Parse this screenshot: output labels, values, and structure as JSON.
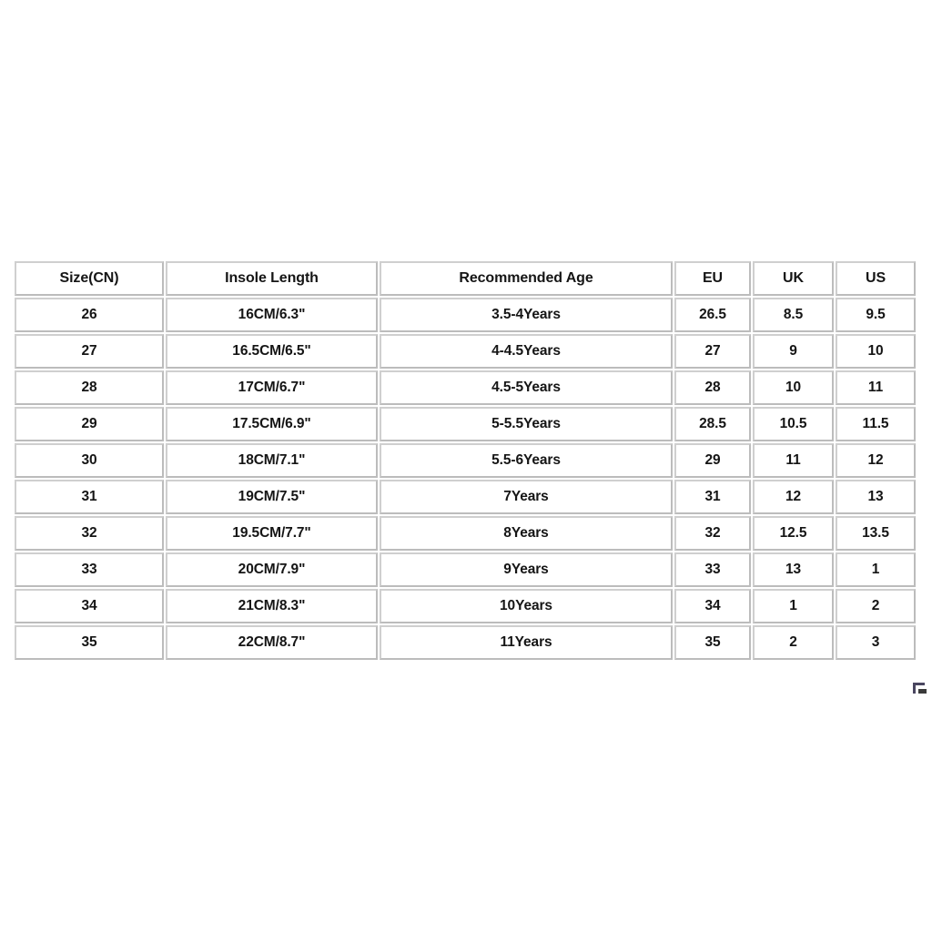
{
  "table": {
    "headers": [
      "Size(CN)",
      "Insole Length",
      "Recommended Age",
      "EU",
      "UK",
      "US"
    ],
    "rows": [
      {
        "size_cn": "26",
        "insole_length": "16CM/6.3\"",
        "recommended_age": "3.5-4Years",
        "eu": "26.5",
        "uk": "8.5",
        "us": "9.5"
      },
      {
        "size_cn": "27",
        "insole_length": "16.5CM/6.5\"",
        "recommended_age": "4-4.5Years",
        "eu": "27",
        "uk": "9",
        "us": "10"
      },
      {
        "size_cn": "28",
        "insole_length": "17CM/6.7\"",
        "recommended_age": "4.5-5Years",
        "eu": "28",
        "uk": "10",
        "us": "11"
      },
      {
        "size_cn": "29",
        "insole_length": "17.5CM/6.9\"",
        "recommended_age": "5-5.5Years",
        "eu": "28.5",
        "uk": "10.5",
        "us": "11.5"
      },
      {
        "size_cn": "30",
        "insole_length": "18CM/7.1\"",
        "recommended_age": "5.5-6Years",
        "eu": "29",
        "uk": "11",
        "us": "12"
      },
      {
        "size_cn": "31",
        "insole_length": "19CM/7.5\"",
        "recommended_age": "7Years",
        "eu": "31",
        "uk": "12",
        "us": "13"
      },
      {
        "size_cn": "32",
        "insole_length": "19.5CM/7.7\"",
        "recommended_age": "8Years",
        "eu": "32",
        "uk": "12.5",
        "us": "13.5"
      },
      {
        "size_cn": "33",
        "insole_length": "20CM/7.9\"",
        "recommended_age": "9Years",
        "eu": "33",
        "uk": "13",
        "us": "1"
      },
      {
        "size_cn": "34",
        "insole_length": "21CM/8.3\"",
        "recommended_age": "10Years",
        "eu": "34",
        "uk": "1",
        "us": "2"
      },
      {
        "size_cn": "35",
        "insole_length": "22CM/8.7\"",
        "recommended_age": "11Years",
        "eu": "35",
        "uk": "2",
        "us": "3"
      }
    ]
  },
  "colors": {
    "background": "#ffffff",
    "cell_background": "#ffffff",
    "border": "#c4c4c4",
    "text": "#151515",
    "corner_mark": "#4a4660"
  }
}
